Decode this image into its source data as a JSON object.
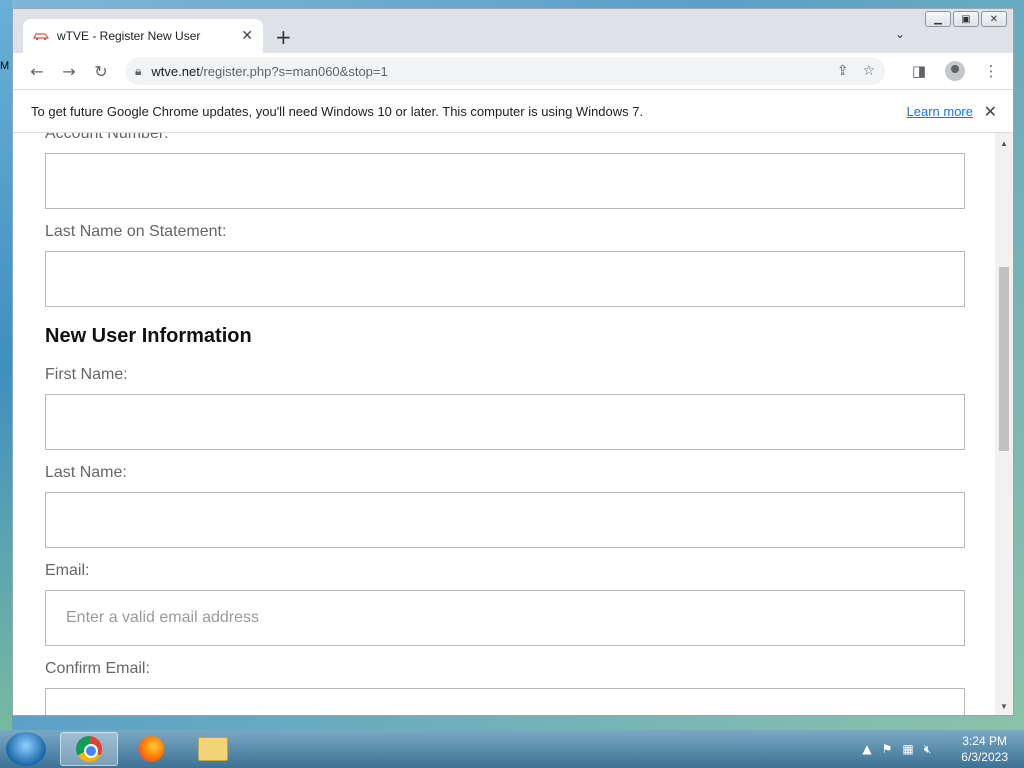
{
  "desktop": {
    "edge_letter": "M"
  },
  "window": {
    "tab_title": "wTVE - Register New User",
    "url_host": "wtve.net",
    "url_path": "/register.php?s=man060&stop=1"
  },
  "infobar": {
    "message": "To get future Google Chrome updates, you'll need Windows 10 or later. This computer is using Windows 7.",
    "learn_more": "Learn more"
  },
  "form": {
    "account_number_label": "Account Number:",
    "last_name_statement_label": "Last Name on Statement:",
    "section_title": "New User Information",
    "first_name_label": "First Name:",
    "last_name_label": "Last Name:",
    "email_label": "Email:",
    "email_placeholder": "Enter a valid email address",
    "confirm_email_label": "Confirm Email:"
  },
  "taskbar": {
    "time": "3:24 PM",
    "date": "6/3/2023"
  },
  "colors": {
    "link": "#1a73e8",
    "tab_icon": "#d9534f"
  }
}
